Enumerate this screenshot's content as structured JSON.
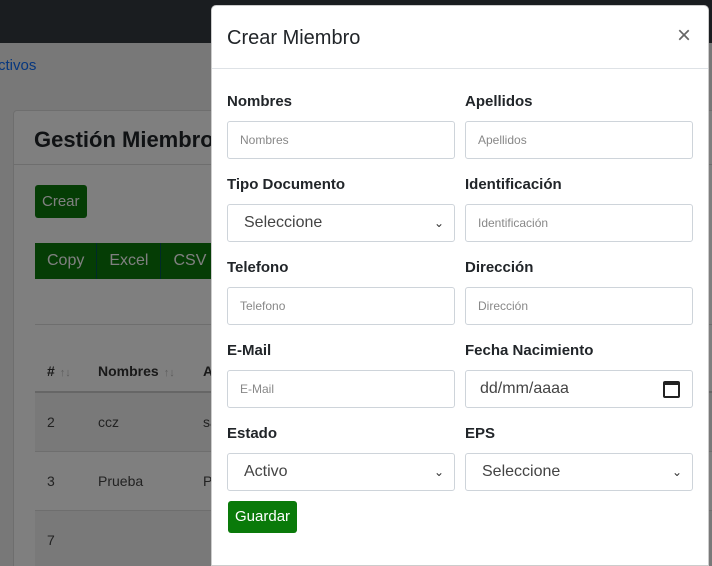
{
  "background": {
    "breadcrumb_link": "ctivos",
    "card_title": "Gestión Miembros",
    "crear_button": "Crear",
    "export_buttons": [
      "Copy",
      "Excel",
      "CSV"
    ],
    "table": {
      "headers": {
        "num": "#",
        "nombres": "Nombres",
        "apellidos": "A"
      },
      "rows": [
        {
          "num": "2",
          "nombres": "ccz",
          "apellidos": "sa"
        },
        {
          "num": "3",
          "nombres": "Prueba",
          "apellidos": "P"
        },
        {
          "num": "7",
          "nombres": "",
          "apellidos": ""
        }
      ]
    }
  },
  "modal": {
    "title": "Crear Miembro",
    "close": "×",
    "fields": {
      "nombres": {
        "label": "Nombres",
        "placeholder": "Nombres"
      },
      "apellidos": {
        "label": "Apellidos",
        "placeholder": "Apellidos"
      },
      "tipo_documento": {
        "label": "Tipo Documento",
        "value": "Seleccione"
      },
      "identificacion": {
        "label": "Identificación",
        "placeholder": "Identificación"
      },
      "telefono": {
        "label": "Telefono",
        "placeholder": "Telefono"
      },
      "direccion": {
        "label": "Dirección",
        "placeholder": "Dirección"
      },
      "email": {
        "label": "E-Mail",
        "placeholder": "E-Mail"
      },
      "fecha_nacimiento": {
        "label": "Fecha Nacimiento",
        "placeholder": "dd/mm/aaaa"
      },
      "estado": {
        "label": "Estado",
        "value": "Activo"
      },
      "eps": {
        "label": "EPS",
        "value": "Seleccione"
      }
    },
    "save_button": "Guardar"
  },
  "colors": {
    "primary_green": "#0a7a0a",
    "topbar": "#343a40",
    "link": "#0d6efd"
  }
}
